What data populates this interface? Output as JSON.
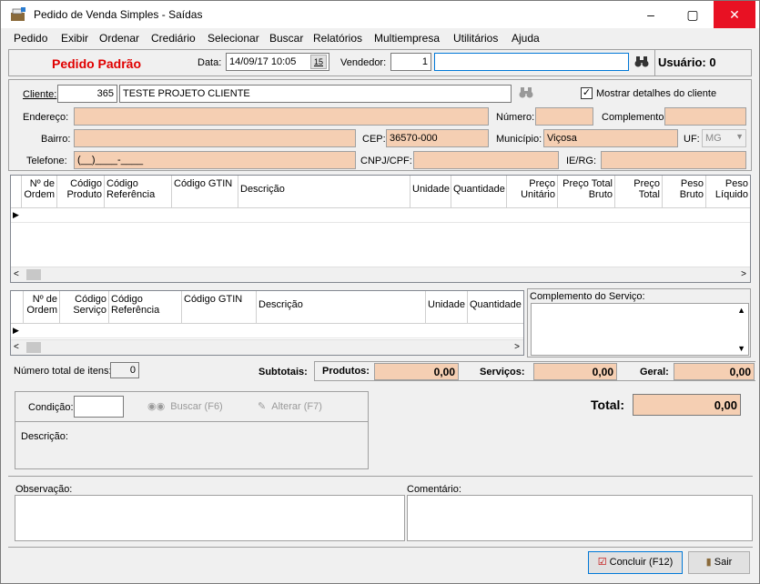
{
  "window": {
    "title": "Pedido de Venda Simples - Saídas",
    "minimize": "‒",
    "maximize": "▢",
    "close": "✕"
  },
  "menu": [
    "Pedido",
    "Exibir",
    "Ordenar",
    "Crediário",
    "Selecionar",
    "Buscar",
    "Relatórios",
    "Multiempresa",
    "Utilitários",
    "Ajuda"
  ],
  "header": {
    "order_type": "Pedido Padrão",
    "date_label": "Data:",
    "date_value": "14/09/17 10:05",
    "calendar_label": "15",
    "seller_label": "Vendedor:",
    "seller_code": "1",
    "seller_name": "",
    "user_text": "Usuário: 0"
  },
  "client": {
    "client_label": "Cliente:",
    "client_code": "365",
    "client_name": "TESTE PROJETO CLIENTE",
    "show_details_label": "Mostrar detalhes do cliente",
    "show_details_checked": true,
    "address_label": "Endereço:",
    "address": "",
    "number_label": "Número:",
    "number": "",
    "complement_label": "Complemento:",
    "complement": "",
    "district_label": "Bairro:",
    "district": "",
    "cep_label": "CEP:",
    "cep": "36570-000",
    "city_label": "Município:",
    "city": "Viçosa",
    "uf_label": "UF:",
    "uf": "MG",
    "phone_label": "Telefone:",
    "phone": "(__)____-____",
    "cnpj_label": "CNPJ/CPF:",
    "cnpj": "",
    "ie_label": "IE/RG:",
    "ie": ""
  },
  "products_grid": {
    "columns": [
      "Nº de Ordem",
      "Código Produto",
      "Código Referência",
      "Código GTIN",
      "Descrição",
      "Unidade",
      "Quantidade",
      "Preço Unitário",
      "Preço Total Bruto",
      "Preço Total",
      "Peso Bruto",
      "Peso Líquido"
    ]
  },
  "services_grid": {
    "columns": [
      "Nº de Ordem",
      "Código Serviço",
      "Código Referência",
      "Código GTIN",
      "Descrição",
      "Unidade",
      "Quantidade"
    ],
    "complement_label": "Complemento do Serviço:"
  },
  "totals": {
    "items_label": "Número total de itens:",
    "items_count": "0",
    "subtotals_label": "Subtotais:",
    "products_label": "Produtos:",
    "products_value": "0,00",
    "services_label": "Serviços:",
    "services_value": "0,00",
    "general_label": "Geral:",
    "general_value": "0,00",
    "total_label": "Total:",
    "total_value": "0,00"
  },
  "payment": {
    "condition_label": "Condição:",
    "condition_value": "",
    "search_button": "Buscar (F6)",
    "edit_button": "Alterar (F7)",
    "description_label": "Descrição:"
  },
  "notes": {
    "observation_label": "Observação:",
    "comment_label": "Comentário:"
  },
  "footer": {
    "finish_button": "Concluir (F12)",
    "exit_button": "Sair"
  }
}
